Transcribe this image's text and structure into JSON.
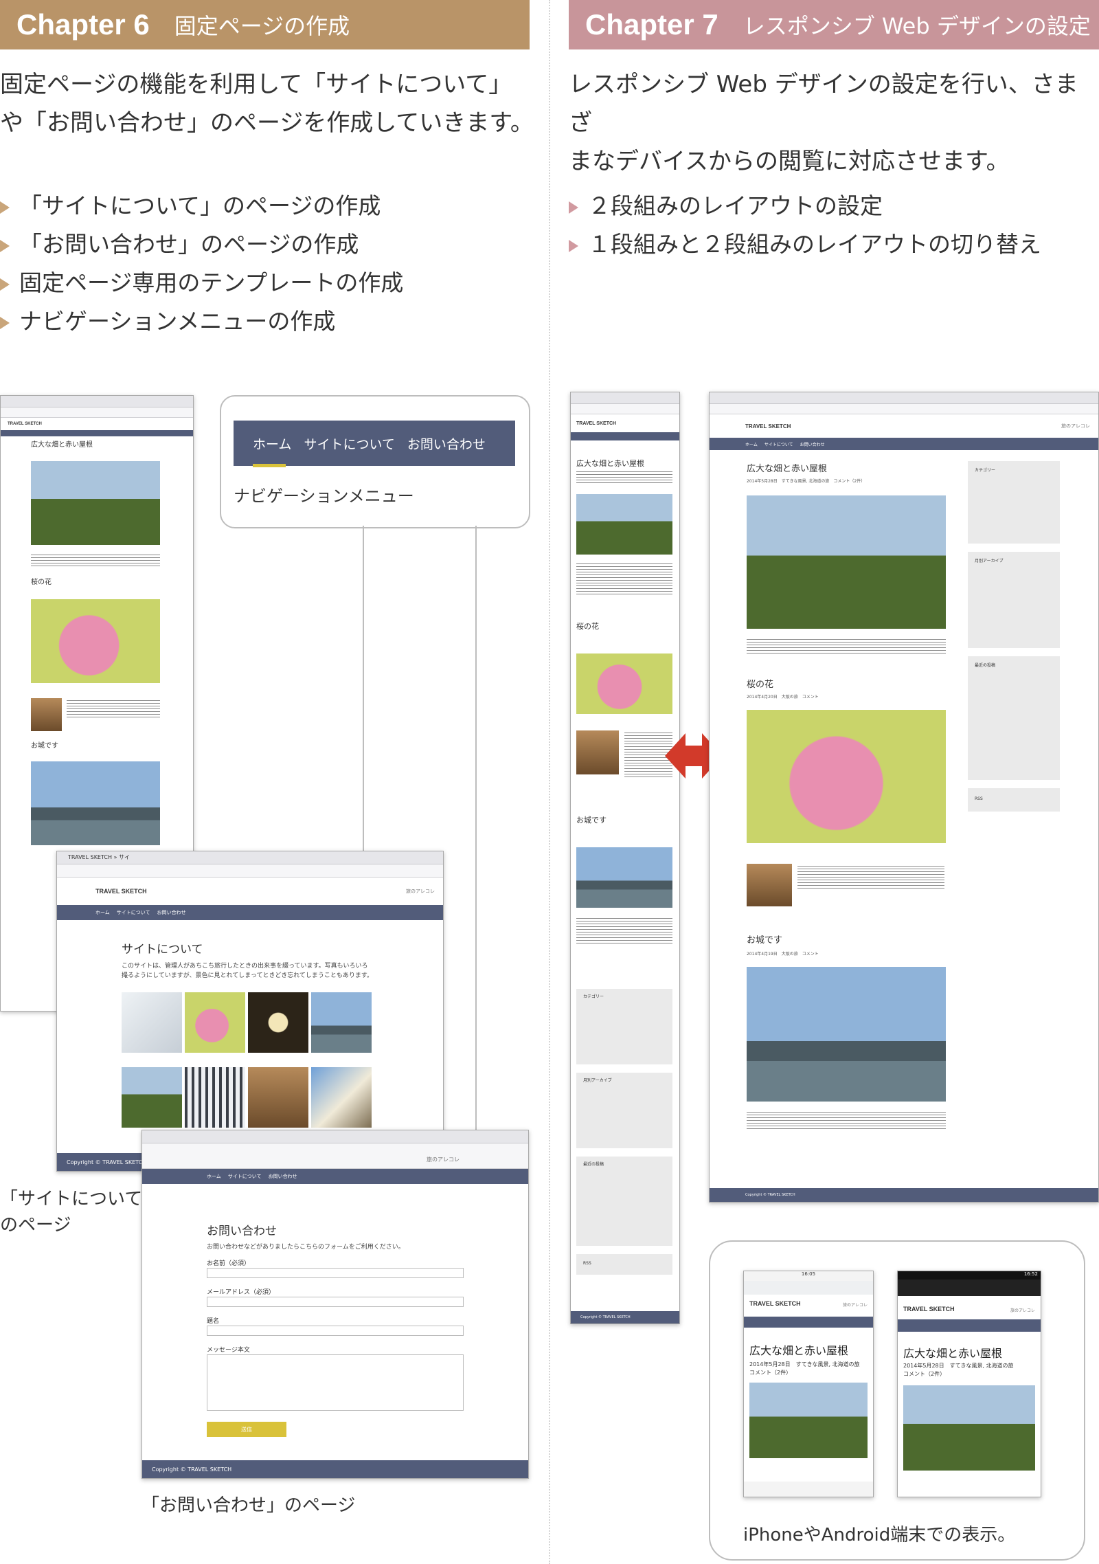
{
  "ch6": {
    "chapter": "Chapter 6",
    "title": "固定ページの作成",
    "intro1": "固定ページの機能を利用して「サイトについて」",
    "intro2": "や「お問い合わせ」のページを作成していきます。",
    "bullets": [
      "「サイトについて」のページの作成",
      "「お問い合わせ」のページの作成",
      "固定ページ専用のテンプレートの作成",
      "ナビゲーションメニューの作成"
    ]
  },
  "ch7": {
    "chapter": "Chapter 7",
    "title": "レスポンシブ Web デザインの設定",
    "intro1": "レスポンシブ Web デザインの設定を行い、さまざ",
    "intro2": "まなデバイスからの閲覧に対応させます。",
    "bullets": [
      "２段組みのレイアウトの設定",
      "１段組みと２段組みのレイアウトの切り替え"
    ]
  },
  "nav_callout": {
    "items": [
      "ホーム",
      "サイトについて",
      "お問い合わせ"
    ],
    "caption": "ナビゲーションメニュー"
  },
  "site": {
    "name": "TRAVEL SKETCH",
    "tagline": "旅のアレコレ",
    "nav": [
      "ホーム",
      "サイトについて",
      "お問い合わせ"
    ],
    "copyright": "Copyright © TRAVEL SKETCH",
    "tab_label": "TRAVEL SKETCH » サイ"
  },
  "posts": {
    "p1_title": "広大な畑と赤い屋根",
    "p1_meta": "2014年5月28日　すてきな風景, 北海道の旅　コメント（2件）",
    "p2_title": "桜の花",
    "p2_meta": "2014年4月20日　大阪の旅　コメント",
    "p3_title": "お城です",
    "p3_meta": "2014年4月19日　大阪の旅　コメント"
  },
  "about": {
    "title": "サイトについて",
    "body1": "このサイトは、管理人があちこち旅行したときの出来事を綴っています。写真もいろいろ",
    "body2": "撮るようにしていますが、景色に見とれてしまってときどき忘れてしまうこともあります。",
    "caption1": "「サイトについて」",
    "caption2": "のページ"
  },
  "contact": {
    "title": "お問い合わせ",
    "lead": "お問い合わせなどがありましたらこちらのフォームをご利用ください。",
    "name_label": "お名前（必須）",
    "email_label": "メールアドレス（必須）",
    "subject_label": "題名",
    "message_label": "メッセージ本文",
    "submit": "送信",
    "caption": "「お問い合わせ」のページ"
  },
  "sidebar": {
    "categories": "カテゴリー",
    "archives": "月別アーカイブ",
    "recent": "最近の投稿",
    "rss": "RSS"
  },
  "mobile": {
    "iphone_time": "16:05",
    "android_time": "16:52",
    "title": "広大な畑と赤い屋根",
    "meta1": "2014年5月28日　すてきな風景, 北海道の旅",
    "meta2": "コメント（2件）",
    "caption": "iPhoneやAndroid端末での表示。"
  },
  "colors": {
    "ch6": "#b99468",
    "ch7": "#c8959a",
    "nav": "#525c7a",
    "accent": "#d9c23a",
    "arrow": "#d23a2a"
  }
}
